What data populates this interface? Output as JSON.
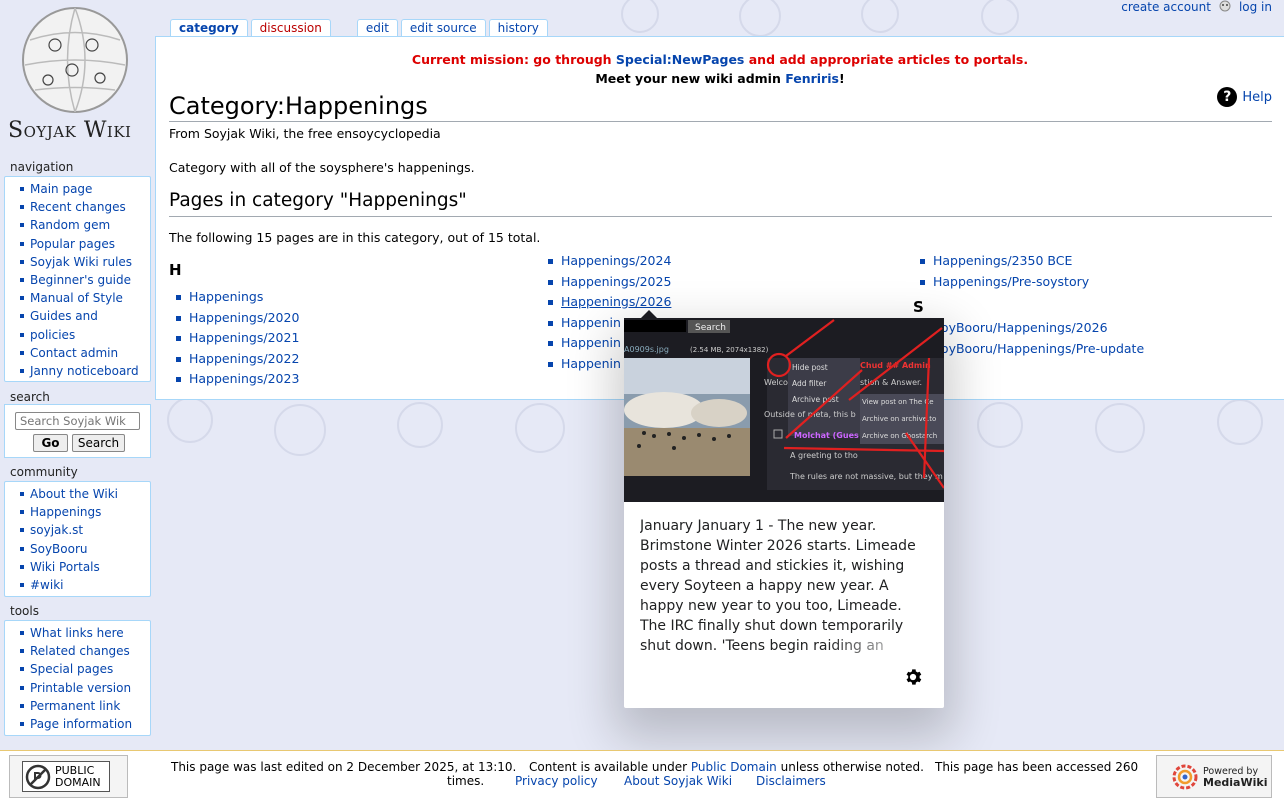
{
  "personal": {
    "create_account": "create account",
    "log_in": "log in"
  },
  "logo": {
    "text": "Soyjak Wiki"
  },
  "tabs": [
    {
      "label": "category"
    },
    {
      "label": "discussion"
    },
    {
      "label": "edit"
    },
    {
      "label": "edit source"
    },
    {
      "label": "history"
    }
  ],
  "notice": {
    "line1_a": "Current mission: go through ",
    "line1_link": "Special:NewPages",
    "line1_b": " and add appropriate articles to portals.",
    "line2_a": "Meet your new wiki admin ",
    "line2_link": "Fenriris",
    "line2_b": "!"
  },
  "help": "Help",
  "page": {
    "title": "Category:Happenings",
    "tagline": "From Soyjak Wiki, the free ensoycyclopedia",
    "description": "Category with all of the soysphere's happenings.",
    "subheading": "Pages in category \"Happenings\"",
    "count_text": "The following 15 pages are in this category, out of 15 total."
  },
  "columns": {
    "col1": {
      "letter": "H",
      "items": [
        "Happenings",
        "Happenings/2020",
        "Happenings/2021",
        "Happenings/2022",
        "Happenings/2023"
      ]
    },
    "col2": {
      "items": [
        "Happenings/2024",
        "Happenings/2025",
        "Happenings/2026",
        "Happenin",
        "Happenin",
        "Happenin"
      ]
    },
    "col3a": {
      "items": [
        "Happenings/2350 BCE",
        "Happenings/Pre-soystory"
      ]
    },
    "col3b": {
      "letter": "S",
      "items": [
        "SoyBooru/Happenings/2026",
        "SoyBooru/Happenings/Pre-update"
      ]
    }
  },
  "sidebar": {
    "navigation": {
      "heading": "navigation",
      "items": [
        "Main page",
        "Recent changes",
        "Random gem",
        "Popular pages",
        "Soyjak Wiki rules",
        "Beginner's guide",
        "Manual of Style",
        "Guides and",
        "policies",
        "Contact admin",
        "Janny noticeboard"
      ]
    },
    "search": {
      "heading": "search",
      "placeholder": "Search Soyjak Wik",
      "go": "Go",
      "search": "Search"
    },
    "community": {
      "heading": "community",
      "items": [
        "About the Wiki",
        "Happenings",
        "soyjak.st",
        "SoyBooru",
        "Wiki Portals",
        "#wiki"
      ]
    },
    "tools": {
      "heading": "tools",
      "items": [
        "What links here",
        "Related changes",
        "Special pages",
        "Printable version",
        "Permanent link",
        "Page information"
      ]
    }
  },
  "popup": {
    "text": "January January 1 - The new year. Brimstone Winter 2026 starts. Limeade posts a thread and stickies it, wishing every Soyteen a happy new year. A happy new year to you too, Limeade. The IRC finally shut down temporarily shut down. 'Teens begin raiding an",
    "image": {
      "search_btn": "Search",
      "file": "A0909s.jpg",
      "meta": "(2.54 MB, 2074x1382)",
      "menu": [
        "Hide post",
        "Add filter",
        "Archive post",
        "View post on The Ce",
        "Archive on archive.to",
        "Archive on Ghostarch"
      ],
      "name": "Chud ## Admin",
      "welcome": "Welco",
      "welcome2": "stion & Answer.",
      "outside": "Outside of meta, this b",
      "molchat": "Molchat (Gues",
      "greeting": "A greeting to tho",
      "rules": "The rules are not massive, but they m"
    }
  },
  "footer": {
    "last_edited": "This page was last edited on 2 December 2025, at 13:10.",
    "content_a": "Content is available under ",
    "content_link": "Public Domain",
    "content_b": " unless otherwise noted.",
    "accessed": "This page has been accessed 260",
    "times": "times.",
    "links": [
      "Privacy policy",
      "About Soyjak Wiki",
      "Disclaimers"
    ],
    "public_domain_badge": [
      "PUBLIC",
      "DOMAIN"
    ],
    "mediawiki_badge": [
      "Powered by",
      "MediaWiki"
    ]
  }
}
